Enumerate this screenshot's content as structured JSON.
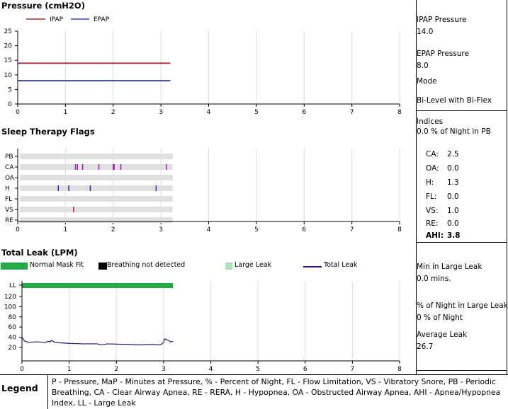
{
  "pressure": {
    "title": "Pressure (cmH2O)",
    "legend": [
      {
        "name": "IPAP",
        "color": "#a03030"
      },
      {
        "name": "EPAP",
        "color": "#3040c0"
      }
    ],
    "yticks": [
      "25",
      "20",
      "15",
      "10",
      "5",
      "0"
    ],
    "xticks": [
      "0",
      "1",
      "2",
      "3",
      "4",
      "5",
      "6",
      "7",
      "8"
    ]
  },
  "flags": {
    "title": "Sleep Therapy Flags",
    "rows": [
      "PB",
      "CA",
      "OA",
      "H",
      "FL",
      "VS",
      "RE"
    ],
    "xticks": [
      "0",
      "1",
      "2",
      "3",
      "4",
      "5",
      "6",
      "7",
      "8"
    ]
  },
  "leak": {
    "title": "Total Leak (LPM)",
    "legend": [
      {
        "name": "Normal Mask Fit",
        "color": "#22aa44"
      },
      {
        "name": "Breathing not detected",
        "color": "#000000"
      },
      {
        "name": "Large Leak",
        "color": "#a8e4b4"
      },
      {
        "name": "Total Leak",
        "color": "#1a1a80"
      }
    ],
    "yticks": [
      "LL",
      "120",
      "100",
      "80",
      "60",
      "40",
      "20"
    ],
    "xticks": [
      "0",
      "1",
      "2",
      "3",
      "4",
      "5",
      "6",
      "7",
      "8"
    ]
  },
  "right_panel": {
    "ipap_label": "IPAP Pressure",
    "ipap_value": "14.0",
    "epap_label": "EPAP Pressure",
    "epap_value": "8.0",
    "mode_label": "Mode",
    "mode_value": "Bi-Level with Bi-Flex",
    "indices_label": "Indices",
    "pb_line": "0.0 % of Night in PB",
    "indices": [
      {
        "label": "CA:",
        "value": "2.5"
      },
      {
        "label": "OA:",
        "value": "0.0"
      },
      {
        "label": "H:",
        "value": "1.3"
      },
      {
        "label": "FL:",
        "value": "0.0"
      },
      {
        "label": "VS:",
        "value": "1.0"
      },
      {
        "label": "RE:",
        "value": "0.0"
      }
    ],
    "ahi_label": "AHI:",
    "ahi_value": "3.8",
    "min_large_leak_label": "Min in Large Leak",
    "min_large_leak_value": "0.0  mins.",
    "pct_large_leak_label": "% of Night in Large Leak",
    "pct_large_leak_value": "0 % of Night",
    "avg_leak_label": "Average Leak",
    "avg_leak_value": "26.7"
  },
  "legend": {
    "label": "Legend",
    "text": "P - Pressure, MaP - Minutes at Pressure, % - Percent of Night, FL - Flow Limitation, VS - Vibratory Snore, PB - Periodic Breathing, CA - Clear Airway Apnea, RE - RERA, H - Hypopnea, OA - Obstructed Airway Apnea, AHI - Apnea/Hypopnea Index, LL - Large Leak"
  },
  "chart_data": [
    {
      "type": "line",
      "title": "Pressure (cmH2O)",
      "xlim": [
        0,
        8
      ],
      "ylim": [
        0,
        25
      ],
      "series": [
        {
          "name": "IPAP",
          "x": [
            0,
            3.2
          ],
          "values": [
            14.0,
            14.0
          ],
          "color": "#a03030"
        },
        {
          "name": "EPAP",
          "x": [
            0,
            3.2
          ],
          "values": [
            8.0,
            8.0
          ],
          "color": "#3040c0"
        }
      ]
    },
    {
      "type": "scatter",
      "title": "Sleep Therapy Flags",
      "xlim": [
        0,
        8
      ],
      "categories": [
        "PB",
        "CA",
        "OA",
        "H",
        "FL",
        "VS",
        "RE"
      ],
      "bar_extent": [
        0,
        3.2
      ],
      "events": [
        {
          "row": "CA",
          "x": 1.21,
          "color": "#a020c0"
        },
        {
          "row": "CA",
          "x": 1.25,
          "color": "#a020c0"
        },
        {
          "row": "CA",
          "x": 1.36,
          "color": "#a020c0"
        },
        {
          "row": "CA",
          "x": 1.7,
          "color": "#a020c0"
        },
        {
          "row": "CA",
          "x": 2.0,
          "color": "#a020c0"
        },
        {
          "row": "CA",
          "x": 2.02,
          "color": "#a020c0"
        },
        {
          "row": "CA",
          "x": 2.16,
          "color": "#a020c0"
        },
        {
          "row": "CA",
          "x": 3.12,
          "color": "#a020c0"
        },
        {
          "row": "H",
          "x": 0.85,
          "color": "#2030a0"
        },
        {
          "row": "H",
          "x": 1.07,
          "color": "#2030a0"
        },
        {
          "row": "H",
          "x": 1.52,
          "color": "#2030a0"
        },
        {
          "row": "H",
          "x": 2.9,
          "color": "#2030a0"
        },
        {
          "row": "VS",
          "x": 1.17,
          "color": "#d02020"
        }
      ]
    },
    {
      "type": "line",
      "title": "Total Leak (LPM)",
      "xlim": [
        0,
        8
      ],
      "ylim": [
        20,
        130
      ],
      "normal_mask_fit": [
        0,
        3.2
      ],
      "series": [
        {
          "name": "Total Leak",
          "color": "#1a1a80",
          "x": [
            0,
            0.05,
            0.1,
            0.15,
            0.3,
            0.5,
            0.55,
            0.6,
            0.62,
            0.7,
            0.8,
            1.0,
            1.3,
            1.6,
            1.7,
            1.8,
            2.2,
            2.5,
            2.75,
            2.9,
            2.95,
            3.0,
            3.02,
            3.1,
            3.15,
            3.2
          ],
          "values": [
            40,
            33,
            31,
            30,
            31,
            30,
            32,
            31,
            34,
            30,
            29,
            28,
            27,
            27,
            25,
            27,
            26,
            25,
            26,
            25,
            26,
            30,
            37,
            34,
            31,
            32
          ]
        }
      ]
    }
  ]
}
